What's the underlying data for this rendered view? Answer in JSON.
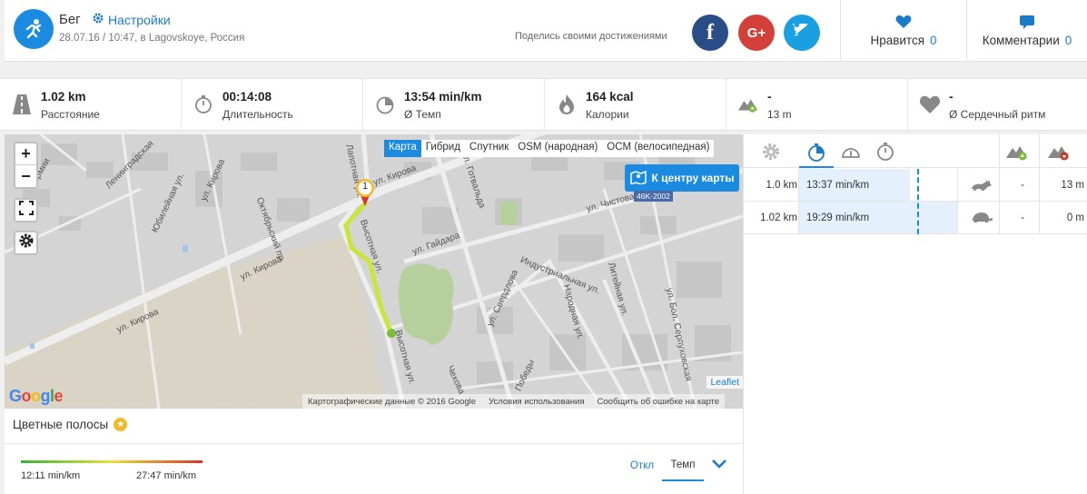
{
  "header": {
    "sport": "Бег",
    "settings_label": "Настройки",
    "meta": "28.07.16 / 10:47, в Lagovskoye, Россия",
    "share_text": "Поделись своими достижениями",
    "social": {
      "facebook": "f",
      "google": "G+",
      "twitter": "t"
    },
    "likes_label": "Нравится",
    "likes_count": "0",
    "comments_label": "Комментарии",
    "comments_count": "0"
  },
  "stats": [
    {
      "value": "1.02 km",
      "label": "Расстояние",
      "icon": "road-icon"
    },
    {
      "value": "00:14:08",
      "label": "Длительность",
      "icon": "stopwatch-icon"
    },
    {
      "value": "13:54 min/km",
      "label": "Ø Темп",
      "icon": "pace-icon"
    },
    {
      "value": "164 kcal",
      "label": "Калории",
      "icon": "flame-icon"
    },
    {
      "value": "-",
      "label": "13 m",
      "icon": "elevation-up-icon"
    },
    {
      "value": "-",
      "label": "Ø Сердечный ритм",
      "icon": "heart-icon"
    }
  ],
  "map": {
    "layers": [
      "Карта",
      "Гибрид",
      "Спутник",
      "OSM (народная)",
      "OCM (велосипедная)"
    ],
    "active_layer": "Карта",
    "center_button": "К центру карты",
    "road_sign": "46K-2002",
    "leaflet": "Leaflet",
    "attribution": [
      "Картографические данные © 2016 Google",
      "Условия использования",
      "Сообщить об ошибке на карте"
    ],
    "marker_label": "1",
    "streets": {
      "kirova1": "ул. Кирова",
      "kirova2": "ул. Кирова",
      "kirova3": "ул. Кирова",
      "gaidara": "ул. Гайдара",
      "chistova": "ул. Чистова",
      "gotvalda": "ул. Готвальда",
      "industrial": "Индустриальная ул.",
      "sverdlova": "ул. Свердлова",
      "narodnaya": "Народная ул.",
      "liteynaya": "Литейная ул.",
      "serpukhov": "ул. Бол. Серпуховская",
      "leningrad": "Ленинградская",
      "yubileynaya": "Юбилейная ул.",
      "oktyabr": "Октябрьский пр.",
      "lapotnaya": "Лапотная ул.",
      "vysotnaya": "Высотная ул.",
      "pobedy": "Победы",
      "chekhova": "Чехова",
      "armii": "Армии"
    }
  },
  "colorbars": {
    "title": "Цветные полосы",
    "min": "12:11 min/km",
    "max": "27:47 min/km",
    "off": "Откл",
    "tempo": "Темп"
  },
  "splits": {
    "rows": [
      {
        "distance": "1.0 km",
        "pace": "13:37 min/km",
        "speed_icon": "rabbit-icon",
        "ascent": "-",
        "descent": "13 m",
        "pace_fraction": 0.7
      },
      {
        "distance": "1.02 km",
        "pace": "19:29 min/km",
        "speed_icon": "turtle-icon",
        "ascent": "-",
        "descent": "0 m",
        "pace_fraction": 1.0
      }
    ]
  },
  "colors": {
    "accent": "#1a8be0",
    "route": "#c8e63a",
    "facebook": "#2b4d87",
    "google": "#d3403a",
    "twitter": "#1aa0e0"
  }
}
